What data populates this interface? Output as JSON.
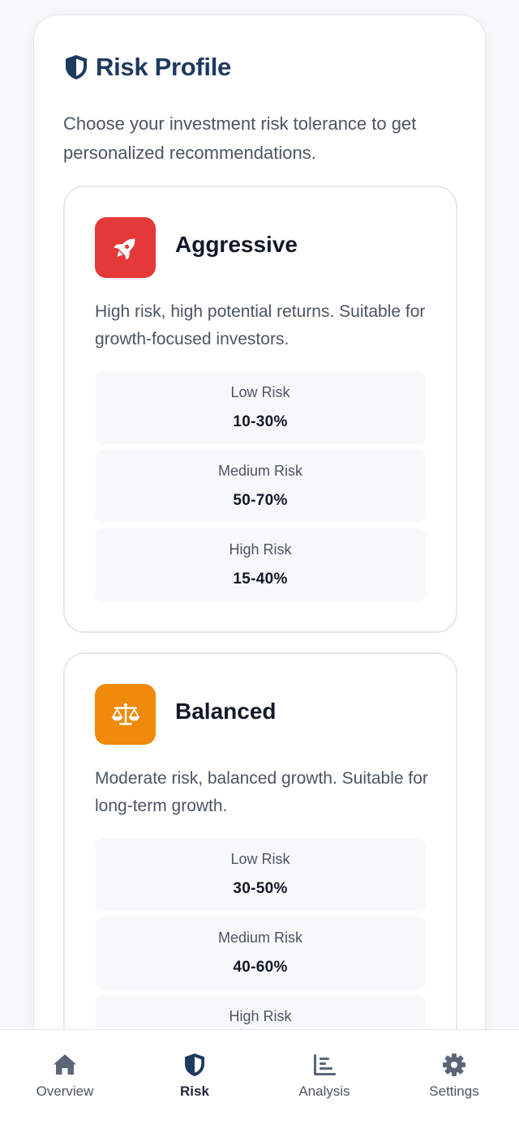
{
  "header": {
    "title": "Risk Profile",
    "icon": "shield-icon",
    "description": "Choose your investment risk tolerance to get personalized recommendations."
  },
  "profiles": [
    {
      "name": "Aggressive",
      "icon": "rocket-icon",
      "color": "#e53838",
      "description": "High risk, high potential returns. Suitable for growth-focused investors.",
      "allocations": [
        {
          "label": "Low Risk",
          "value": "10-30%"
        },
        {
          "label": "Medium Risk",
          "value": "50-70%"
        },
        {
          "label": "High Risk",
          "value": "15-40%"
        }
      ]
    },
    {
      "name": "Balanced",
      "icon": "scale-icon",
      "color": "#ef8a0a",
      "description": "Moderate risk, balanced growth. Suitable for long-term growth.",
      "allocations": [
        {
          "label": "Low Risk",
          "value": "30-50%"
        },
        {
          "label": "Medium Risk",
          "value": "40-60%"
        },
        {
          "label": "High Risk",
          "value": ""
        }
      ]
    }
  ],
  "nav": {
    "active": "Risk",
    "items": [
      {
        "label": "Overview",
        "icon": "home-icon"
      },
      {
        "label": "Risk",
        "icon": "shield-icon"
      },
      {
        "label": "Analysis",
        "icon": "chart-icon"
      },
      {
        "label": "Settings",
        "icon": "gear-icon"
      }
    ]
  },
  "colors": {
    "primary": "#1e3a5f",
    "nav_icon": "#5b6678"
  }
}
